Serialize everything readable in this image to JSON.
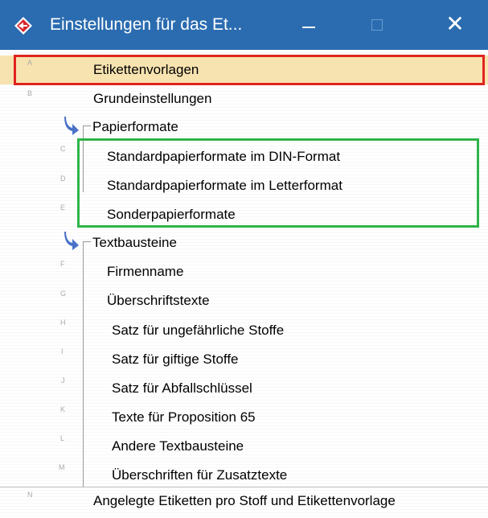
{
  "window": {
    "title": "Einstellungen für das Et...",
    "close_glyph": "✕"
  },
  "items": [
    {
      "letter": "A",
      "label": "Etikettenvorlagen"
    },
    {
      "letter": "B",
      "label": "Grundeinstellungen"
    },
    {
      "letter": "",
      "label": "Papierformate"
    },
    {
      "letter": "C",
      "label": "Standardpapierformate im DIN-Format"
    },
    {
      "letter": "D",
      "label": "Standardpapierformate im Letterformat"
    },
    {
      "letter": "E",
      "label": "Sonderpapierformate"
    },
    {
      "letter": "",
      "label": "Textbausteine"
    },
    {
      "letter": "F",
      "label": "Firmenname"
    },
    {
      "letter": "G",
      "label": "Überschriftstexte"
    },
    {
      "letter": "H",
      "label": "Satz für ungefährliche Stoffe"
    },
    {
      "letter": "I",
      "label": "Satz für giftige Stoffe"
    },
    {
      "letter": "J",
      "label": "Satz für Abfallschlüssel"
    },
    {
      "letter": "K",
      "label": "Texte für Proposition 65"
    },
    {
      "letter": "L",
      "label": "Andere Textbausteine"
    },
    {
      "letter": "M",
      "label": "Überschriften für Zusatztexte"
    },
    {
      "letter": "N",
      "label": "Angelegte Etiketten pro Stoff und Etikettenvorlage"
    }
  ],
  "colors": {
    "titlebar": "#2b6cb0",
    "selected_row": "#f7e3b0",
    "highlight_red": "#e0231f",
    "highlight_green": "#2fb44a",
    "expand_arrow": "#4a72c8"
  }
}
